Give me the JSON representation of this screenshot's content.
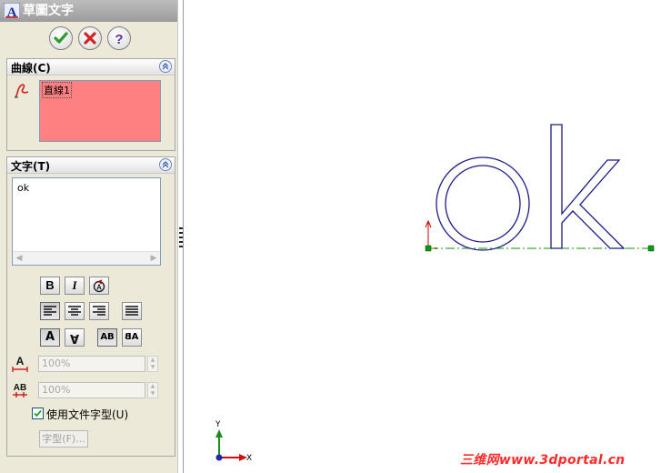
{
  "property_manager": {
    "title": "草圖文字",
    "actions": {
      "ok_icon": "checkmark-icon",
      "cancel_icon": "x-icon",
      "help_icon": "question-icon"
    }
  },
  "curves_group": {
    "title": "曲線(C)",
    "items": [
      "直線1"
    ],
    "list_color": "#ff8080"
  },
  "text_group": {
    "title": "文字(T)",
    "content": "ok",
    "format_buttons": {
      "bold": "B",
      "italic": "I"
    },
    "letter_buttons": [
      "A",
      "A",
      "AB",
      "AB"
    ],
    "width_factor": "100%",
    "spacing": "100%",
    "use_document_font": {
      "label": "使用文件字型(U)",
      "checked": true
    },
    "font_button": "字型(F)..."
  },
  "canvas": {
    "axis_x": "X",
    "axis_y": "Y",
    "curve_color": "#1a1a8c",
    "construction_color": "#009900"
  },
  "watermark": "三维网www.3dportal.cn"
}
